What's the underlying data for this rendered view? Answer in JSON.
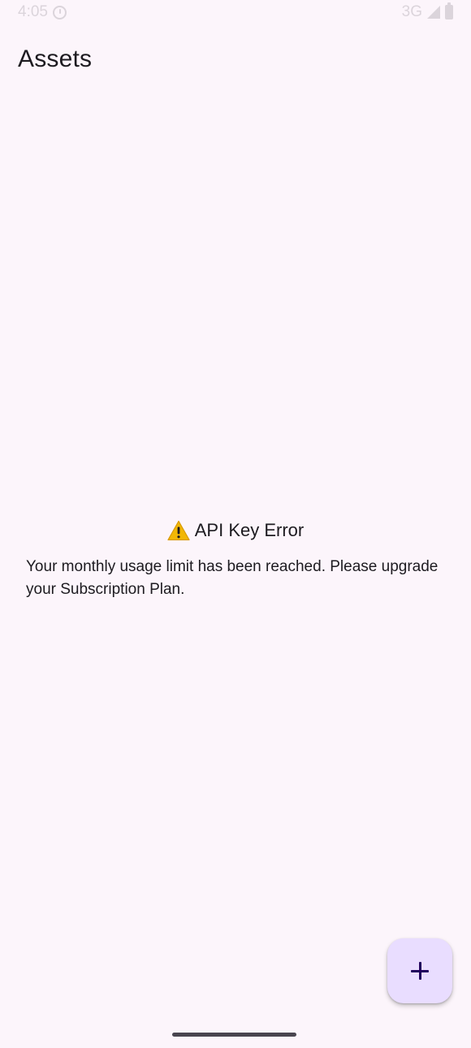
{
  "status_bar": {
    "time": "4:05",
    "network": "3G",
    "icons": [
      "do-not-disturb-icon",
      "signal-icon",
      "battery-icon"
    ]
  },
  "app_bar": {
    "title": "Assets"
  },
  "error": {
    "icon": "warning-icon",
    "title": "API Key Error",
    "message": "Your monthly usage limit has been reached. Please upgrade your Subscription Plan."
  },
  "fab": {
    "icon": "plus-icon"
  },
  "colors": {
    "background": "#fcf5fb",
    "fab_background": "#e9ddff",
    "fab_icon": "#21005d",
    "warning": "#f2b705",
    "text": "#1d1b20"
  }
}
